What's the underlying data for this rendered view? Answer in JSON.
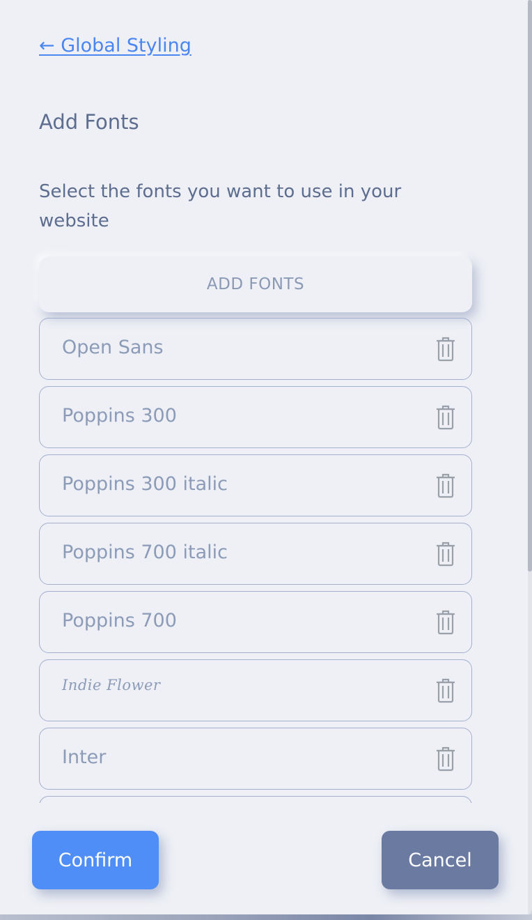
{
  "nav": {
    "back_label": "← Global Styling"
  },
  "header": {
    "title": "Add Fonts",
    "description": "Select the fonts you want to use in your website"
  },
  "add_button_label": "ADD FONTS",
  "fonts": [
    {
      "name": "Open Sans",
      "icon": "trash-icon"
    },
    {
      "name": "Poppins 300",
      "icon": "trash-icon"
    },
    {
      "name": "Poppins 300 italic",
      "icon": "trash-icon"
    },
    {
      "name": "Poppins 700 italic",
      "icon": "trash-icon"
    },
    {
      "name": "Poppins 700",
      "icon": "trash-icon"
    },
    {
      "name": "Indie Flower",
      "icon": "trash-icon"
    },
    {
      "name": "Inter",
      "icon": "trash-icon"
    },
    {
      "name": "",
      "icon": ""
    }
  ],
  "actions": {
    "confirm_label": "Confirm",
    "cancel_label": "Cancel"
  },
  "colors": {
    "link": "#4a86f0",
    "confirm": "#4f8ef7",
    "cancel": "#6a7aa1",
    "text": "#5d6d8f",
    "muted": "#8b9bb8",
    "border": "#a3b0d0"
  }
}
